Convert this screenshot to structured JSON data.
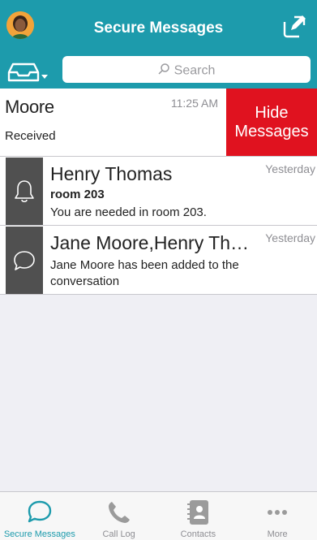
{
  "header": {
    "title": "Secure Messages",
    "avatar": "user-avatar",
    "compose_icon": "compose-icon"
  },
  "search": {
    "placeholder": "Search",
    "filter_icon": "inbox-tray-icon"
  },
  "swiped_row": {
    "name": "Moore",
    "time": "11:25 AM",
    "status": "Received",
    "action_label": "Hide Messages",
    "action_line1": "Hide",
    "action_line2": "Messages",
    "action_color": "#e0121f"
  },
  "conversations": [
    {
      "icon": "bell-icon",
      "name": "Henry Thomas",
      "time": "Yesterday",
      "subject": "room 203",
      "preview": "You are needed in room 203."
    },
    {
      "icon": "chat-bubble-icon",
      "name": "Jane Moore,Henry Th…",
      "time": "Yesterday",
      "subject": "",
      "preview": "Jane Moore has been added to the conversation"
    }
  ],
  "tabs": [
    {
      "label": "Secure Messages",
      "icon": "chat-bubble-icon",
      "active": true
    },
    {
      "label": "Call Log",
      "icon": "phone-icon",
      "active": false
    },
    {
      "label": "Contacts",
      "icon": "contacts-book-icon",
      "active": false
    },
    {
      "label": "More",
      "icon": "more-dots-icon",
      "active": false
    }
  ],
  "colors": {
    "accent": "#1d9bac",
    "destructive": "#e0121f",
    "icon_column": "#505050"
  }
}
